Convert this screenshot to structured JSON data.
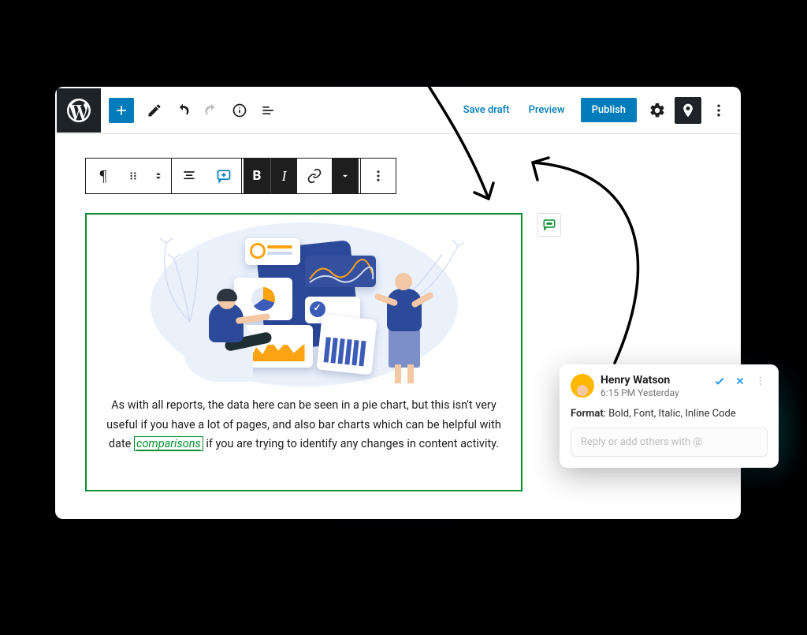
{
  "header": {
    "save_draft": "Save draft",
    "preview": "Preview",
    "publish": "Publish"
  },
  "content": {
    "paragraph_before": "As with all reports, the data here can be seen in a pie chart, but this isn't very useful if you have a lot of pages, and also bar charts which can be helpful with date ",
    "highlighted": "comparisons",
    "paragraph_after": " if you are trying to identify any changes in content activity."
  },
  "comment": {
    "author": "Henry Watson",
    "timestamp": "6:15 PM Yesterday",
    "body_label": "Format",
    "body_value": ": Bold, Font, Italic, Inline Code",
    "reply_placeholder": "Reply or add others with @"
  }
}
